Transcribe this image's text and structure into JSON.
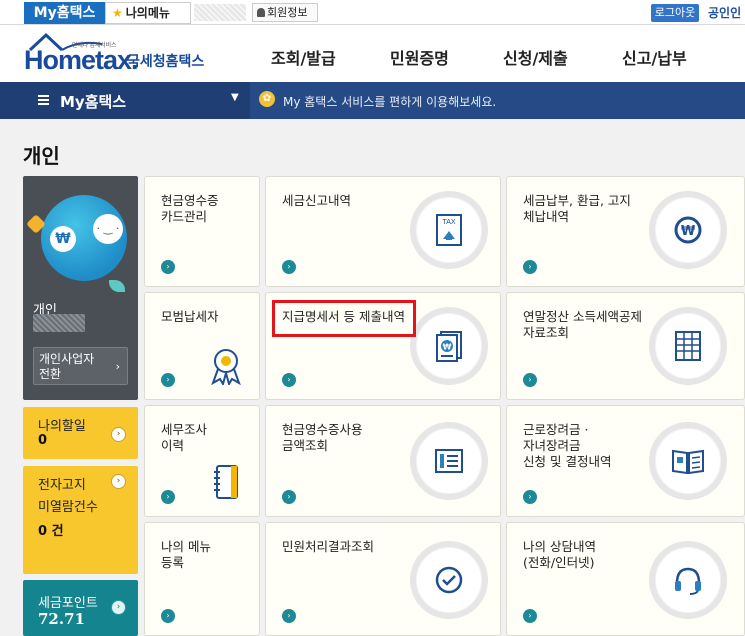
{
  "topbar": {
    "my_hometax": "My홈택스",
    "my_menu": "나의메뉴",
    "member_info": "회원정보",
    "logout": "로그아웃",
    "cert": "공인인"
  },
  "header": {
    "logo_small": "언제나 납세서비스",
    "logo_main": "Hometax.",
    "logo_sub": "국세청홈택스",
    "gnb": [
      "조회/발급",
      "민원증명",
      "신청/제출",
      "신고/납부"
    ]
  },
  "navbar": {
    "title": "My홈택스",
    "message": "My 홈택스 서비스를 편하게 이용해보세요."
  },
  "page_title": "개인",
  "profile": {
    "name": "개인",
    "switch_button": "개인사업자\n전환"
  },
  "side": {
    "discount_label": "나의할일",
    "discount_value": "0",
    "notice_label_1": "전자고지",
    "notice_label_2": "미열람건수",
    "notice_value": "0 건",
    "points_label": "세금포인트",
    "points_value": "72.71"
  },
  "cards": [
    {
      "label": "현금영수증\n카드관리",
      "icon": "none"
    },
    {
      "label": "세금신고내역",
      "icon": "tax-document-icon"
    },
    {
      "label": "세금납부, 환급, 고지\n체납내역",
      "icon": "won-coin-icon"
    },
    {
      "label": "모범납세자",
      "icon": "award-ribbon-icon"
    },
    {
      "label": "지급명세서 등 제출내역",
      "icon": "won-document-icon"
    },
    {
      "label": "연말정산 소득세액공제\n자료조회",
      "icon": "spreadsheet-icon"
    },
    {
      "label": "세무조사\n이력",
      "icon": "binder-icon"
    },
    {
      "label": "현금영수증사용\n금액조회",
      "icon": "receipt-list-icon"
    },
    {
      "label": "근로장려금 ·\n자녀장려금\n신청 및 결정내역",
      "icon": "open-book-icon"
    },
    {
      "label": "나의 메뉴\n등록",
      "icon": "none"
    },
    {
      "label": "민원처리결과조회",
      "icon": "check-circle-icon"
    },
    {
      "label": "나의 상담내역\n(전화/인터넷)",
      "icon": "headset-icon"
    }
  ],
  "colors": {
    "brand_blue": "#1a4a9c",
    "nav_bg": "#254a85",
    "highlight": "#e3151a",
    "side_yellow": "#f8c72d",
    "side_teal": "#14858f"
  }
}
